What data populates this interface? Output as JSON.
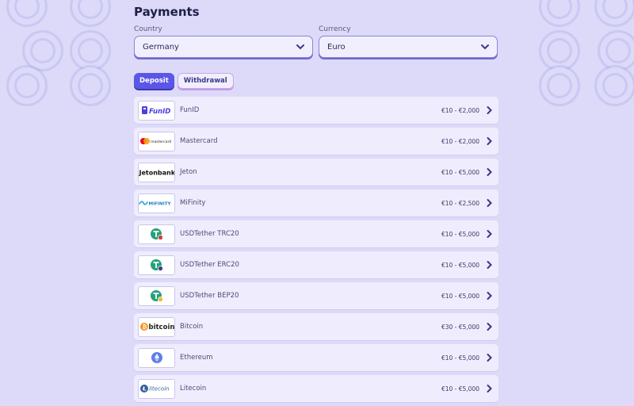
{
  "page": {
    "title": "Payments"
  },
  "filters": {
    "country_label": "Country",
    "country_value": "Germany",
    "currency_label": "Currency",
    "currency_value": "Euro"
  },
  "tabs": [
    {
      "label": "Deposit",
      "active": true
    },
    {
      "label": "Withdrawal",
      "active": false
    }
  ],
  "methods": [
    {
      "name": "FunID",
      "range": "€10 - €2,000",
      "logo": "funid-logo",
      "logo_text": "FunID"
    },
    {
      "name": "Mastercard",
      "range": "€10 - €2,000",
      "logo": "mastercard-logo",
      "logo_text": "mastercard"
    },
    {
      "name": "Jeton",
      "range": "€10 - €5,000",
      "logo": "jetonbank-logo",
      "logo_text": "Jetonbank"
    },
    {
      "name": "MiFinity",
      "range": "€10 - €2,500",
      "logo": "mifinity-logo",
      "logo_text": "MiFINITY"
    },
    {
      "name": "USDTether TRC20",
      "range": "€10 - €5,000",
      "logo": "tether-trc20-icon",
      "badge_color": "#e0343a"
    },
    {
      "name": "USDTether ERC20",
      "range": "€10 - €5,000",
      "logo": "tether-erc20-icon",
      "badge_color": "#3a3f8f"
    },
    {
      "name": "USDTether BEP20",
      "range": "€10 - €5,000",
      "logo": "tether-bep20-icon",
      "badge_color": "#f3ba2f"
    },
    {
      "name": "Bitcoin",
      "range": "€30 - €5,000",
      "logo": "bitcoin-logo",
      "logo_text": "bitcoin"
    },
    {
      "name": "Ethereum",
      "range": "€10 - €5,000",
      "logo": "ethereum-icon"
    },
    {
      "name": "Litecoin",
      "range": "€10 - €5,000",
      "logo": "litecoin-logo",
      "logo_text": "litecoin"
    }
  ],
  "colors": {
    "background": "#dcdaf8",
    "accent": "#5b56e6",
    "chevron": "#3b3888",
    "tether": "#26a17b",
    "bitcoin": "#f7931a",
    "ethereum": "#627eea",
    "litecoin": "#345d9d",
    "mastercard_red": "#eb001b",
    "mastercard_orange": "#f79e1b",
    "funid": "#4a3fe0",
    "mifinity": "#1fa3d9"
  }
}
